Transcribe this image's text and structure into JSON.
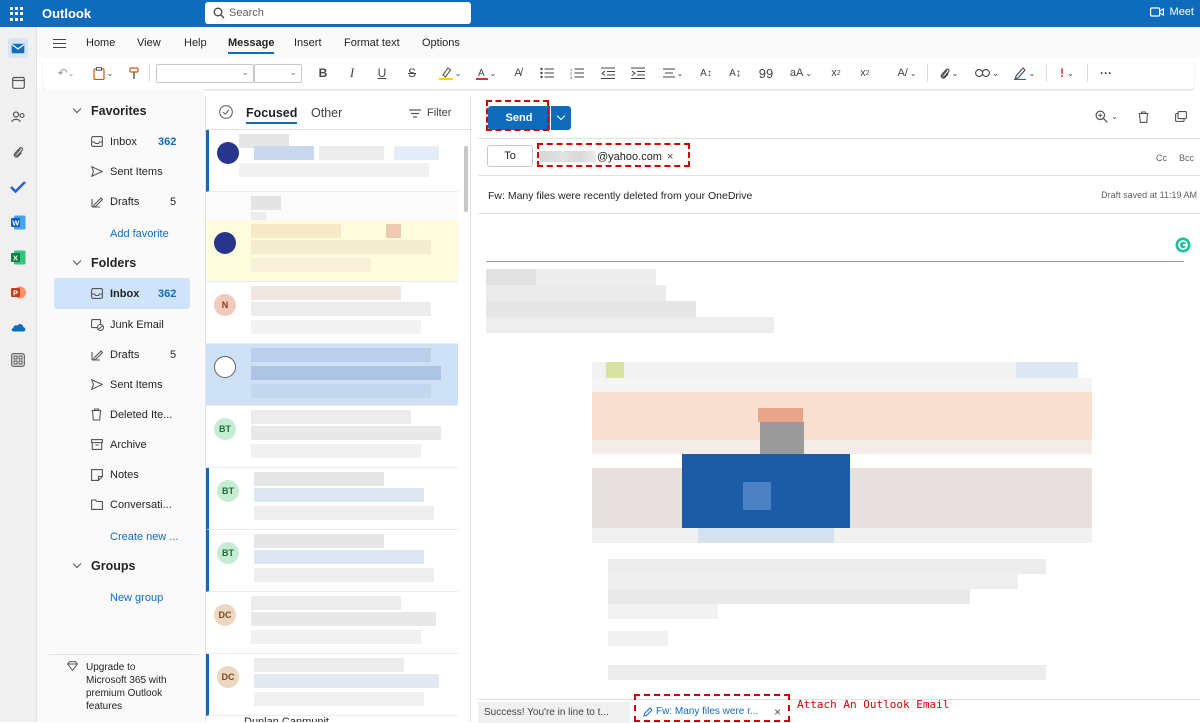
{
  "app": {
    "title": "Outlook",
    "search_placeholder": "Search",
    "meet_label": "Meet"
  },
  "ribbon": {
    "tabs": [
      {
        "label": "Home",
        "active": false
      },
      {
        "label": "View",
        "active": false
      },
      {
        "label": "Help",
        "active": false
      },
      {
        "label": "Message",
        "active": true
      },
      {
        "label": "Insert",
        "active": false
      },
      {
        "label": "Format text",
        "active": false
      },
      {
        "label": "Options",
        "active": false
      }
    ]
  },
  "nav": {
    "favorites_label": "Favorites",
    "favorites": [
      {
        "label": "Inbox",
        "count": "362",
        "icon": "inbox-icon"
      },
      {
        "label": "Sent Items",
        "count": "",
        "icon": "send-icon"
      },
      {
        "label": "Drafts",
        "count": "5",
        "icon": "drafts-icon"
      }
    ],
    "add_favorite": "Add favorite",
    "folders_label": "Folders",
    "folders": [
      {
        "label": "Inbox",
        "count": "362",
        "icon": "inbox-icon",
        "selected": true
      },
      {
        "label": "Junk Email",
        "count": "",
        "icon": "junk-icon"
      },
      {
        "label": "Drafts",
        "count": "5",
        "icon": "drafts-icon"
      },
      {
        "label": "Sent Items",
        "count": "",
        "icon": "send-icon"
      },
      {
        "label": "Deleted Ite...",
        "count": "",
        "icon": "trash-icon"
      },
      {
        "label": "Archive",
        "count": "",
        "icon": "archive-icon"
      },
      {
        "label": "Notes",
        "count": "",
        "icon": "notes-icon"
      },
      {
        "label": "Conversati...",
        "count": "",
        "icon": "folder-icon"
      }
    ],
    "create_new": "Create new ...",
    "groups_label": "Groups",
    "new_group": "New group",
    "upgrade_text": [
      "Upgrade to",
      "Microsoft 365 with",
      "premium Outlook",
      "features"
    ]
  },
  "message_list": {
    "tabs": {
      "focused": "Focused",
      "other": "Other"
    },
    "filter_label": "Filter",
    "rows": [
      {
        "avatar": "",
        "avatar_color": "#27368c",
        "unread": true
      },
      {
        "avatar": "",
        "avatar_color": "",
        "unread": false
      },
      {
        "avatar": "",
        "avatar_color": "#27368c",
        "unread": false,
        "highlight": "#fffbdd"
      },
      {
        "avatar": "N",
        "avatar_color": "#e8b7a9",
        "unread": false
      },
      {
        "avatar": "",
        "avatar_color": "",
        "unread": false,
        "selected": true
      },
      {
        "avatar": "BT",
        "avatar_color": "#b9e8c9",
        "unread": false
      },
      {
        "avatar": "BT",
        "avatar_color": "#b9e8c9",
        "unread": true
      },
      {
        "avatar": "BT",
        "avatar_color": "#b9e8c9",
        "unread": true
      },
      {
        "avatar": "DC",
        "avatar_color": "#e5cbb1",
        "unread": false
      },
      {
        "avatar": "DC",
        "avatar_color": "#e5cbb1",
        "unread": true
      }
    ],
    "partial_sender": "Dunlan Canmunit"
  },
  "compose": {
    "send_label": "Send",
    "to_label": "To",
    "recipient": "@yahoo.com",
    "cc_label": "Cc",
    "bcc_label": "Bcc",
    "subject": "Fw: Many files were recently deleted from your OneDrive",
    "draft_status": "Draft saved at 11:19 AM"
  },
  "status": {
    "success_text": "Success! You're in line to t...",
    "draft_tab": "Fw: Many files were r...",
    "annotation": "Attach An Outlook Email"
  },
  "colors": {
    "accent": "#0f6cbd",
    "annotation": "#d40000"
  }
}
